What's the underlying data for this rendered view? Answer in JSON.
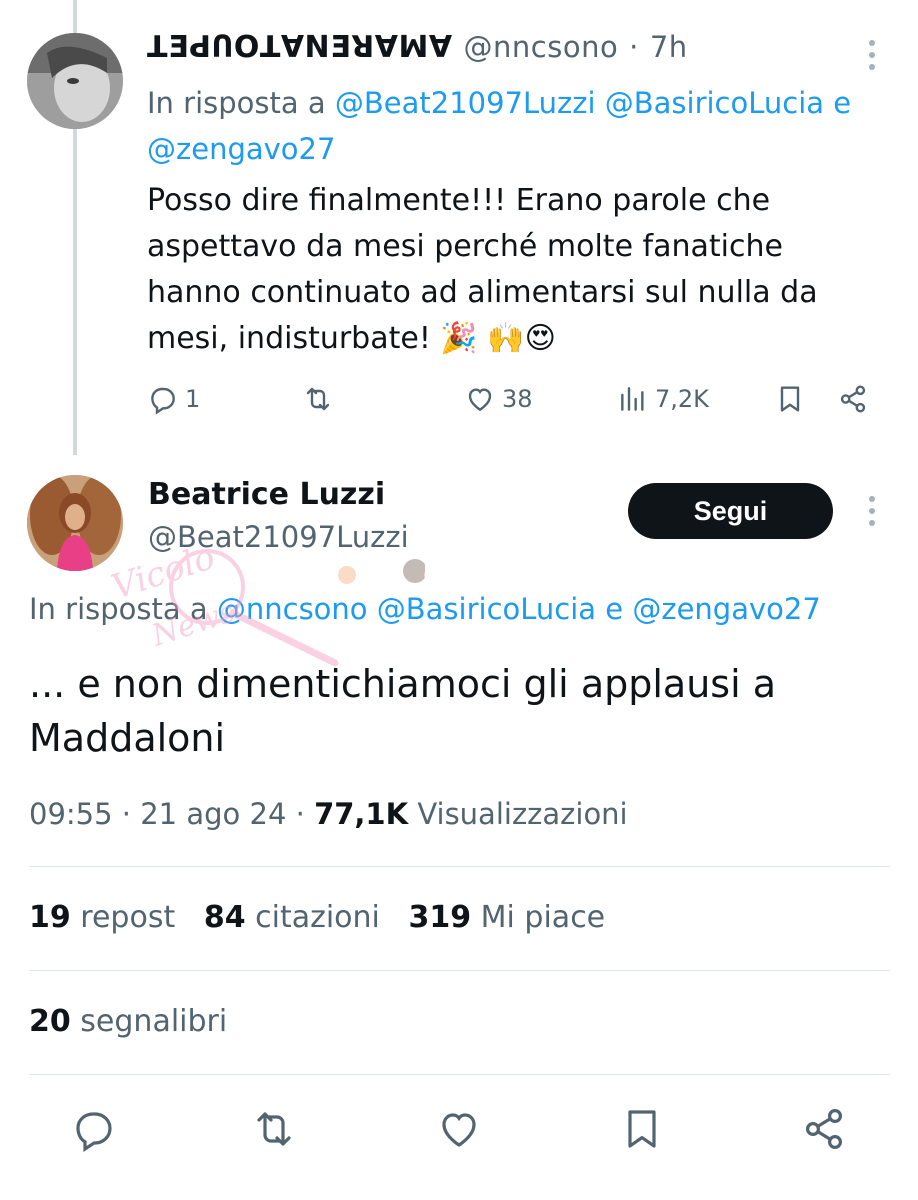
{
  "reply_tweet": {
    "display_name": "ꓕƎꓒՈOꓕ∀NƎꓤ∀ꟽ∀",
    "handle": "@nncsono",
    "separator": "·",
    "time": "7h",
    "reply_prefix": "In risposta a",
    "mentions": [
      "@Beat21097Luzzi",
      "@BasiricoLucia"
    ],
    "conjunction": "e",
    "last_mention": "@zengavo27",
    "text": "Posso dire finalmente!!!  Erano parole che aspettavo da mesi perché molte fanatiche hanno continuato ad alimentarsi sul nulla da mesi, indisturbate!  🎉 🙌😍",
    "replies": "1",
    "reposts": "",
    "likes": "38",
    "views": "7,2K"
  },
  "main_tweet": {
    "display_name": "Beatrice Luzzi",
    "handle": "@Beat21097Luzzi",
    "follow_label": "Segui",
    "reply_prefix": "In risposta a",
    "mentions": [
      "@nncsono",
      "@BasiricoLucia"
    ],
    "conjunction": "e",
    "last_mention": "@zengavo27",
    "text": "... e non dimentichiamoci gli applausi a Maddaloni",
    "time": "09:55",
    "sep1": "·",
    "date": "21 ago 24",
    "sep2": "·",
    "views_count": "77,1K",
    "views_label": "Visualizzazioni",
    "reposts_count": "19",
    "reposts_label": "repost",
    "quotes_count": "84",
    "quotes_label": "citazioni",
    "likes_count": "319",
    "likes_label": "Mi piace",
    "bookmarks_count": "20",
    "bookmarks_label": "segnalibri"
  },
  "watermark": "Vicolo delle News",
  "colors": {
    "link": "#1d9bf0",
    "muted": "#536471",
    "text": "#0f1419",
    "button": "#0f1419"
  },
  "icons": [
    "reply-icon",
    "repost-icon",
    "like-icon",
    "views-icon",
    "bookmark-icon",
    "share-icon",
    "more-icon"
  ]
}
